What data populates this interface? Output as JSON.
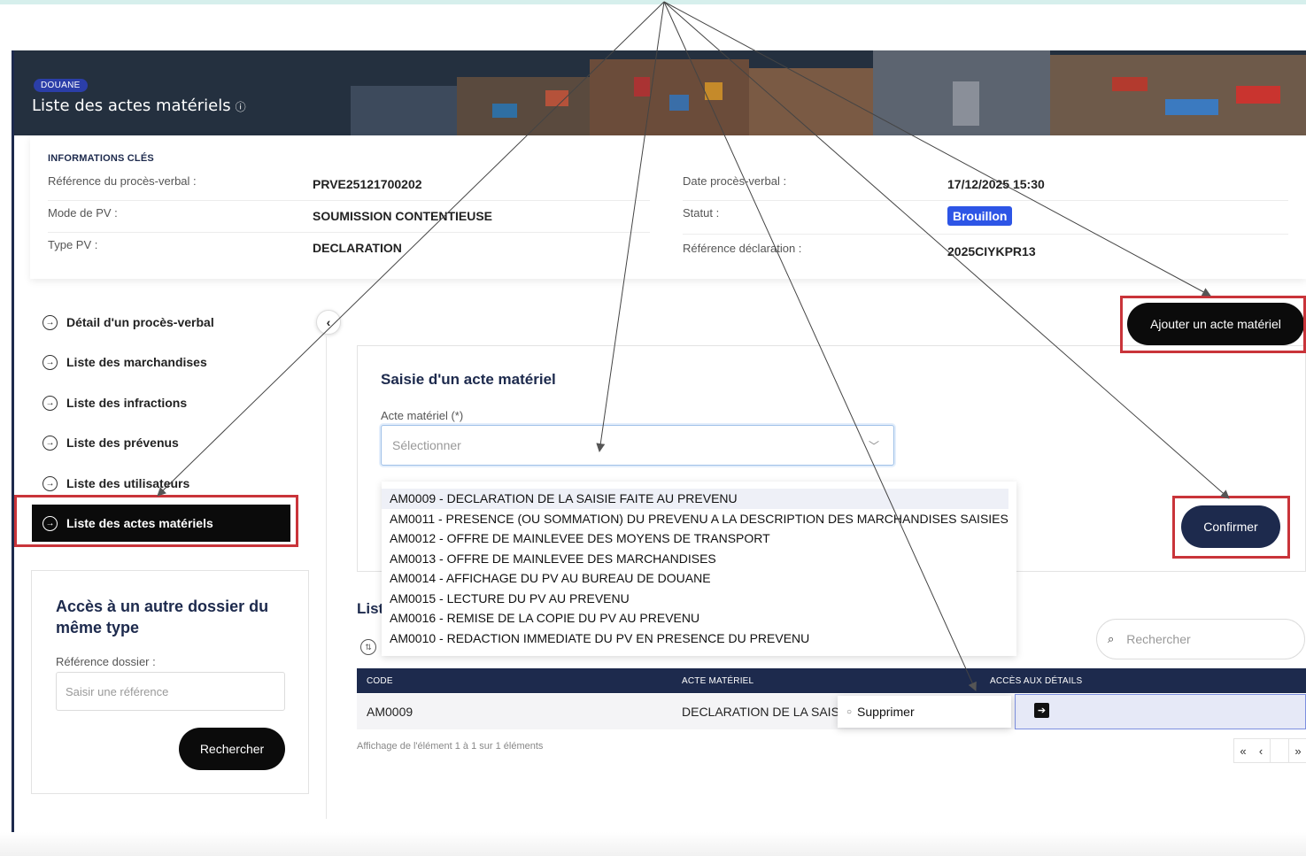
{
  "banner": {
    "badge": "DOUANE",
    "title": "Liste des actes matériels",
    "info_glyph": "ⓘ"
  },
  "key_info": {
    "header": "INFORMATIONS CLÉS",
    "ref_pv_label": "Référence du procès-verbal :",
    "ref_pv_value": "PRVE25121700202",
    "mode_label": "Mode de PV :",
    "mode_value": "SOUMISSION CONTENTIEUSE",
    "type_label": "Type PV :",
    "type_value": "DECLARATION",
    "date_label": "Date procès-verbal :",
    "date_value": "17/12/2025 15:30",
    "statut_label": "Statut :",
    "statut_value": "Brouillon",
    "ref_decl_label": "Référence déclaration :",
    "ref_decl_value": "2025CIYKPR13"
  },
  "sidebar": {
    "items": [
      {
        "label": "Détail d'un procès-verbal"
      },
      {
        "label": "Liste des marchandises"
      },
      {
        "label": "Liste des infractions"
      },
      {
        "label": "Liste des prévenus"
      },
      {
        "label": "Liste des utilisateurs"
      },
      {
        "label": "Liste des actes matériels"
      }
    ],
    "collapse_glyph": "‹"
  },
  "other_dossier": {
    "title": "Accès à un autre dossier du même type",
    "label": "Référence dossier :",
    "placeholder": "Saisir une référence",
    "button": "Rechercher"
  },
  "actions": {
    "add_button": "Ajouter un acte matériel",
    "confirm_button": "Confirmer"
  },
  "saisie": {
    "title": "Saisie d'un acte matériel",
    "field_label": "Acte matériel (*)",
    "placeholder": "Sélectionner",
    "options": [
      "AM0009 - DECLARATION DE LA SAISIE FAITE AU PREVENU",
      "AM0011 - PRESENCE (OU SOMMATION) DU PREVENU A LA DESCRIPTION DES MARCHANDISES SAISIES",
      "AM0012 - OFFRE DE MAINLEVEE DES MOYENS DE TRANSPORT",
      "AM0013 - OFFRE DE MAINLEVEE DES MARCHANDISES",
      "AM0014 - AFFICHAGE DU PV AU BUREAU DE DOUANE",
      "AM0015 - LECTURE DU PV AU PREVENU",
      "AM0016 - REMISE DE LA COPIE DU PV AU PREVENU",
      "AM0010 - REDACTION IMMEDIATE DU PV EN PRESENCE DU PREVENU"
    ]
  },
  "list": {
    "title_partial": "List",
    "search_placeholder": "Rechercher",
    "columns": [
      "CODE",
      "ACTE MATÉRIEL",
      "ACCÈS AUX DÉTAILS"
    ],
    "rows": [
      {
        "code": "AM0009",
        "acte": "DECLARATION DE LA SAISIE"
      }
    ],
    "row_menu": "Supprimer",
    "footer": "Affichage de l'élément 1 à 1 sur 1 éléments",
    "pager": [
      "«",
      "‹",
      "»"
    ]
  },
  "colors": {
    "navy": "#1d2a4d",
    "highlight_red": "#c9343a",
    "status_blue": "#2d55e6"
  }
}
